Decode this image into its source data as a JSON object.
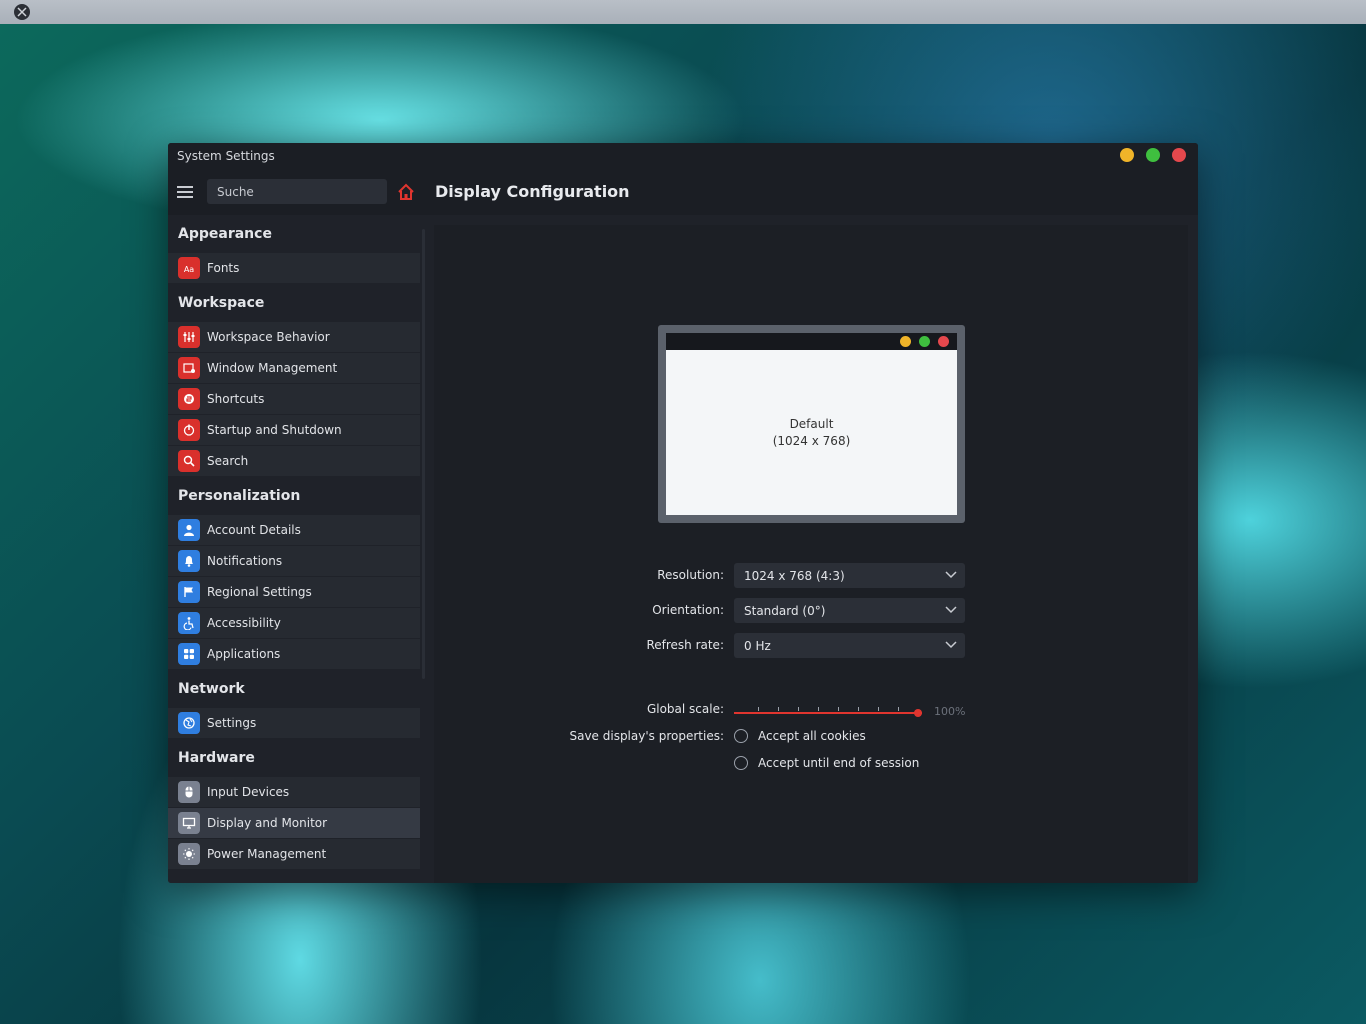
{
  "window": {
    "title": "System Settings",
    "controls": {
      "minimize_color": "#f0b429",
      "maximize_color": "#3fbf3f",
      "close_color": "#e5484d"
    }
  },
  "toolbar": {
    "search_placeholder": "Suche",
    "page_title": "Display Configuration"
  },
  "sidebar": {
    "sections": [
      {
        "title": "Appearance",
        "items": [
          {
            "label": "Fonts",
            "icon": "fonts-icon",
            "color": "red"
          }
        ]
      },
      {
        "title": "Workspace",
        "items": [
          {
            "label": "Workspace Behavior",
            "icon": "sliders-icon",
            "color": "red"
          },
          {
            "label": "Window Management",
            "icon": "window-gear-icon",
            "color": "red"
          },
          {
            "label": "Shortcuts",
            "icon": "shortcut-icon",
            "color": "red"
          },
          {
            "label": "Startup and Shutdown",
            "icon": "power-icon",
            "color": "red"
          },
          {
            "label": "Search",
            "icon": "search-icon",
            "color": "red"
          }
        ]
      },
      {
        "title": "Personalization",
        "items": [
          {
            "label": "Account Details",
            "icon": "user-icon",
            "color": "blue"
          },
          {
            "label": "Notifications",
            "icon": "bell-icon",
            "color": "blue"
          },
          {
            "label": "Regional Settings",
            "icon": "flag-icon",
            "color": "blue"
          },
          {
            "label": "Accessibility",
            "icon": "accessibility-icon",
            "color": "blue"
          },
          {
            "label": "Applications",
            "icon": "apps-grid-icon",
            "color": "blue"
          }
        ]
      },
      {
        "title": "Network",
        "items": [
          {
            "label": "Settings",
            "icon": "globe-icon",
            "color": "blue"
          }
        ]
      },
      {
        "title": "Hardware",
        "items": [
          {
            "label": "Input Devices",
            "icon": "mouse-icon",
            "color": "gray"
          },
          {
            "label": "Display and Monitor",
            "icon": "monitor-icon",
            "color": "gray",
            "active": true
          },
          {
            "label": "Power Management",
            "icon": "bulb-icon",
            "color": "gray"
          }
        ]
      }
    ]
  },
  "display": {
    "preview_name": "Default",
    "preview_resolution": "(1024 x 768)",
    "resolution_label": "Resolution:",
    "resolution_value": "1024 x 768 (4:3)",
    "orientation_label": "Orientation:",
    "orientation_value": "Standard (0°)",
    "refresh_label": "Refresh rate:",
    "refresh_value": "0 Hz",
    "scale_label": "Global scale:",
    "scale_value": "100%",
    "scale_level": 1.0,
    "save_label": "Save display's properties:",
    "save_options": [
      "Accept all cookies",
      "Accept until end of session"
    ]
  }
}
